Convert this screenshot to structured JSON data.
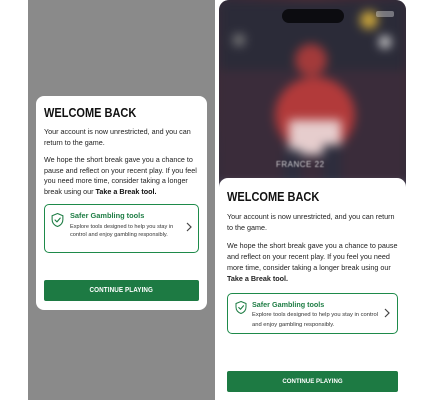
{
  "dialog": {
    "title": "WELCOME BACK",
    "paragraph1": "Your account is now unrestricted, and you can return to the game.",
    "paragraph2_prefix": "We hope the short break gave you a chance to pause and reflect on your recent play. If you feel you need more time, consider taking a longer break using our ",
    "paragraph2_link": "Take a Break tool.",
    "tools": {
      "title": "Safer Gambling tools",
      "description": "Explore tools designed to help you stay in control and enjoy gambling responsibly.",
      "icon": "shield-check-icon",
      "chevron": "chevron-right-icon"
    },
    "continue_label": "CONTINUE PLAYING"
  },
  "background": {
    "caption": "FRANCE 22"
  },
  "colors": {
    "accent_green": "#1d7a43",
    "tools_title_green": "#1e7d44",
    "overlay_grey": "#8a8a8a"
  }
}
